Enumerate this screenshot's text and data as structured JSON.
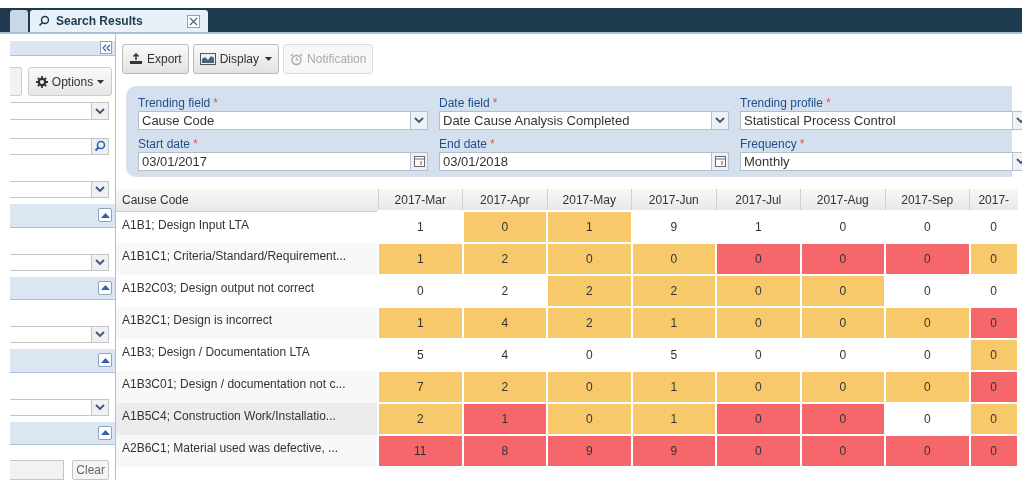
{
  "tabs": [
    {
      "selected": false
    },
    {
      "label": "Search Results",
      "selected": true
    }
  ],
  "sidebar": {
    "options_button": "Options",
    "items": [
      {
        "kind": "select"
      },
      {
        "kind": "search"
      },
      {
        "kind": "select"
      },
      {
        "kind": "section"
      },
      {
        "kind": "select"
      },
      {
        "kind": "section"
      },
      {
        "kind": "select"
      },
      {
        "kind": "section"
      },
      {
        "kind": "select"
      },
      {
        "kind": "section"
      },
      {
        "kind": "clear",
        "label": "Clear"
      }
    ]
  },
  "toolbar": [
    {
      "label": "Export",
      "dropdown": false,
      "disabled": false
    },
    {
      "label": "Display",
      "dropdown": true,
      "disabled": false
    },
    {
      "label": "Notification",
      "dropdown": false,
      "disabled": true
    }
  ],
  "filters": [
    {
      "label": "Trending field",
      "required_mark": "*",
      "value": "Cause Code",
      "kind": "select"
    },
    {
      "label": "Date field",
      "required_mark": "*",
      "value": "Date Cause Analysis Completed",
      "kind": "select"
    },
    {
      "label": "Trending profile",
      "required_mark": "*",
      "value": "Statistical Process Control",
      "kind": "select"
    },
    {
      "label": "Start date",
      "required_mark": "*",
      "value": "03/01/2017",
      "kind": "date"
    },
    {
      "label": "End date",
      "required_mark": "*",
      "value": "03/01/2018",
      "kind": "date"
    },
    {
      "label": "Frequency",
      "required_mark": "*",
      "value": "Monthly",
      "kind": "select"
    }
  ],
  "table": {
    "columns": [
      "Cause Code",
      "2017-Mar",
      "2017-Apr",
      "2017-May",
      "2017-Jun",
      "2017-Jul",
      "2017-Aug",
      "2017-Sep",
      "2017-"
    ],
    "rows": [
      {
        "hovered": false,
        "cells": [
          {
            "value": "A1B1; Design Input LTA"
          },
          {
            "value": "1",
            "color": "#ffffff"
          },
          {
            "value": "0",
            "color": "#f7c96a"
          },
          {
            "value": "1",
            "color": "#f7c96a"
          },
          {
            "value": "9",
            "color": "#ffffff"
          },
          {
            "value": "1",
            "color": "#ffffff"
          },
          {
            "value": "0",
            "color": "#ffffff"
          },
          {
            "value": "0",
            "color": "#ffffff"
          },
          {
            "value": "0",
            "color": "#ffffff"
          }
        ]
      },
      {
        "hovered": false,
        "cells": [
          {
            "value": "A1B1C1; Criteria/Standard/Requirement..."
          },
          {
            "value": "1",
            "color": "#f7c96a"
          },
          {
            "value": "2",
            "color": "#f7c96a"
          },
          {
            "value": "0",
            "color": "#f7c96a"
          },
          {
            "value": "0",
            "color": "#f7c96a"
          },
          {
            "value": "0",
            "color": "#f6676b"
          },
          {
            "value": "0",
            "color": "#f6676b"
          },
          {
            "value": "0",
            "color": "#f6676b"
          },
          {
            "value": "0",
            "color": "#f7c96a"
          }
        ]
      },
      {
        "hovered": false,
        "cells": [
          {
            "value": "A1B2C03; Design output not correct"
          },
          {
            "value": "0",
            "color": "#ffffff"
          },
          {
            "value": "2",
            "color": "#ffffff"
          },
          {
            "value": "2",
            "color": "#f7c96a"
          },
          {
            "value": "2",
            "color": "#f7c96a"
          },
          {
            "value": "0",
            "color": "#f7c96a"
          },
          {
            "value": "0",
            "color": "#f7c96a"
          },
          {
            "value": "0",
            "color": "#ffffff"
          },
          {
            "value": "0",
            "color": "#ffffff"
          }
        ]
      },
      {
        "hovered": false,
        "cells": [
          {
            "value": "A1B2C1; Design is incorrect"
          },
          {
            "value": "1",
            "color": "#f7c96a"
          },
          {
            "value": "4",
            "color": "#f7c96a"
          },
          {
            "value": "2",
            "color": "#f7c96a"
          },
          {
            "value": "1",
            "color": "#f7c96a"
          },
          {
            "value": "0",
            "color": "#f7c96a"
          },
          {
            "value": "0",
            "color": "#f7c96a"
          },
          {
            "value": "0",
            "color": "#f7c96a"
          },
          {
            "value": "0",
            "color": "#f6676b"
          }
        ]
      },
      {
        "hovered": false,
        "cells": [
          {
            "value": "A1B3; Design / Documentation LTA"
          },
          {
            "value": "5",
            "color": "#ffffff"
          },
          {
            "value": "4",
            "color": "#ffffff"
          },
          {
            "value": "0",
            "color": "#ffffff"
          },
          {
            "value": "5",
            "color": "#ffffff"
          },
          {
            "value": "0",
            "color": "#ffffff"
          },
          {
            "value": "0",
            "color": "#ffffff"
          },
          {
            "value": "0",
            "color": "#ffffff"
          },
          {
            "value": "0",
            "color": "#f7c96a"
          }
        ]
      },
      {
        "hovered": false,
        "cells": [
          {
            "value": "A1B3C01; Design / documentation not c..."
          },
          {
            "value": "7",
            "color": "#f7c96a"
          },
          {
            "value": "2",
            "color": "#f7c96a"
          },
          {
            "value": "0",
            "color": "#f7c96a"
          },
          {
            "value": "1",
            "color": "#f7c96a"
          },
          {
            "value": "0",
            "color": "#f7c96a"
          },
          {
            "value": "0",
            "color": "#f7c96a"
          },
          {
            "value": "0",
            "color": "#f7c96a"
          },
          {
            "value": "0",
            "color": "#f6676b"
          }
        ]
      },
      {
        "hovered": true,
        "cells": [
          {
            "value": "A1B5C4; Construction Work/Installatio..."
          },
          {
            "value": "2",
            "color": "#f7c96a"
          },
          {
            "value": "1",
            "color": "#f6676b"
          },
          {
            "value": "0",
            "color": "#f7c96a"
          },
          {
            "value": "1",
            "color": "#f7c96a"
          },
          {
            "value": "0",
            "color": "#f6676b"
          },
          {
            "value": "0",
            "color": "#f6676b"
          },
          {
            "value": "0",
            "color": "#ffffff"
          },
          {
            "value": "0",
            "color": "#f7c96a"
          }
        ]
      },
      {
        "hovered": false,
        "cells": [
          {
            "value": "A2B6C1; Material used was defective, ..."
          },
          {
            "value": "11",
            "color": "#f6676b"
          },
          {
            "value": "8",
            "color": "#f6676b"
          },
          {
            "value": "9",
            "color": "#f6676b"
          },
          {
            "value": "9",
            "color": "#f6676b"
          },
          {
            "value": "0",
            "color": "#f6676b"
          },
          {
            "value": "0",
            "color": "#f6676b"
          },
          {
            "value": "0",
            "color": "#f6676b"
          },
          {
            "value": "0",
            "color": "#f6676b"
          }
        ]
      }
    ]
  }
}
